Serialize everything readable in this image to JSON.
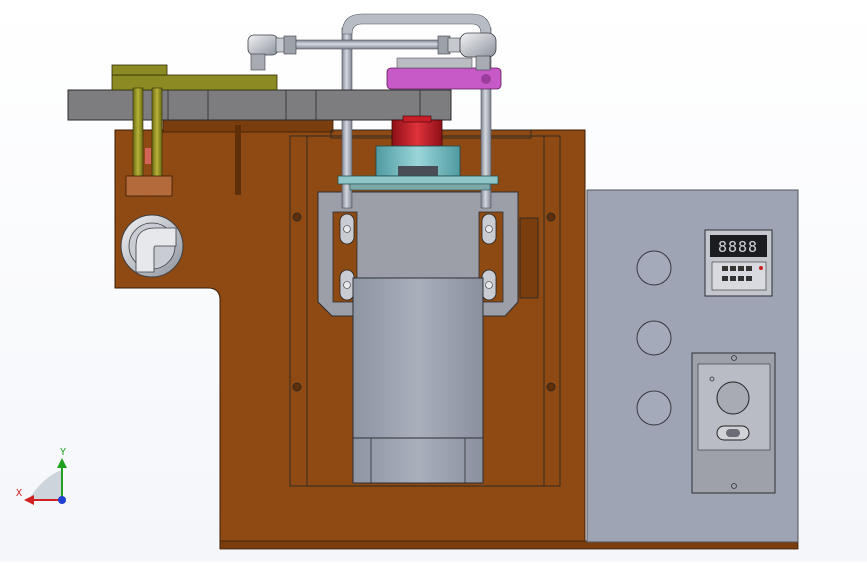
{
  "viewport": {
    "background": "#ffffff",
    "colors": {
      "wood": "#8e4a12",
      "wood_dark": "#5e2f08",
      "plate_gray": "#7d7d80",
      "panel": "#9fa4b4",
      "motor": "#9aa0ad",
      "pipe": "#a9aeb8",
      "rod_olive": "#8c8a22",
      "bracket_magenta": "#c85ac8",
      "coupling_red": "#c81e28",
      "hub_teal": "#6fb2b8"
    }
  },
  "triad": {
    "x_label": "X",
    "y_label": "Y",
    "x_color": "#d02020",
    "y_color": "#20a020",
    "z_color": "#1f3fd0"
  },
  "timer_display": {
    "digits": "8888"
  }
}
